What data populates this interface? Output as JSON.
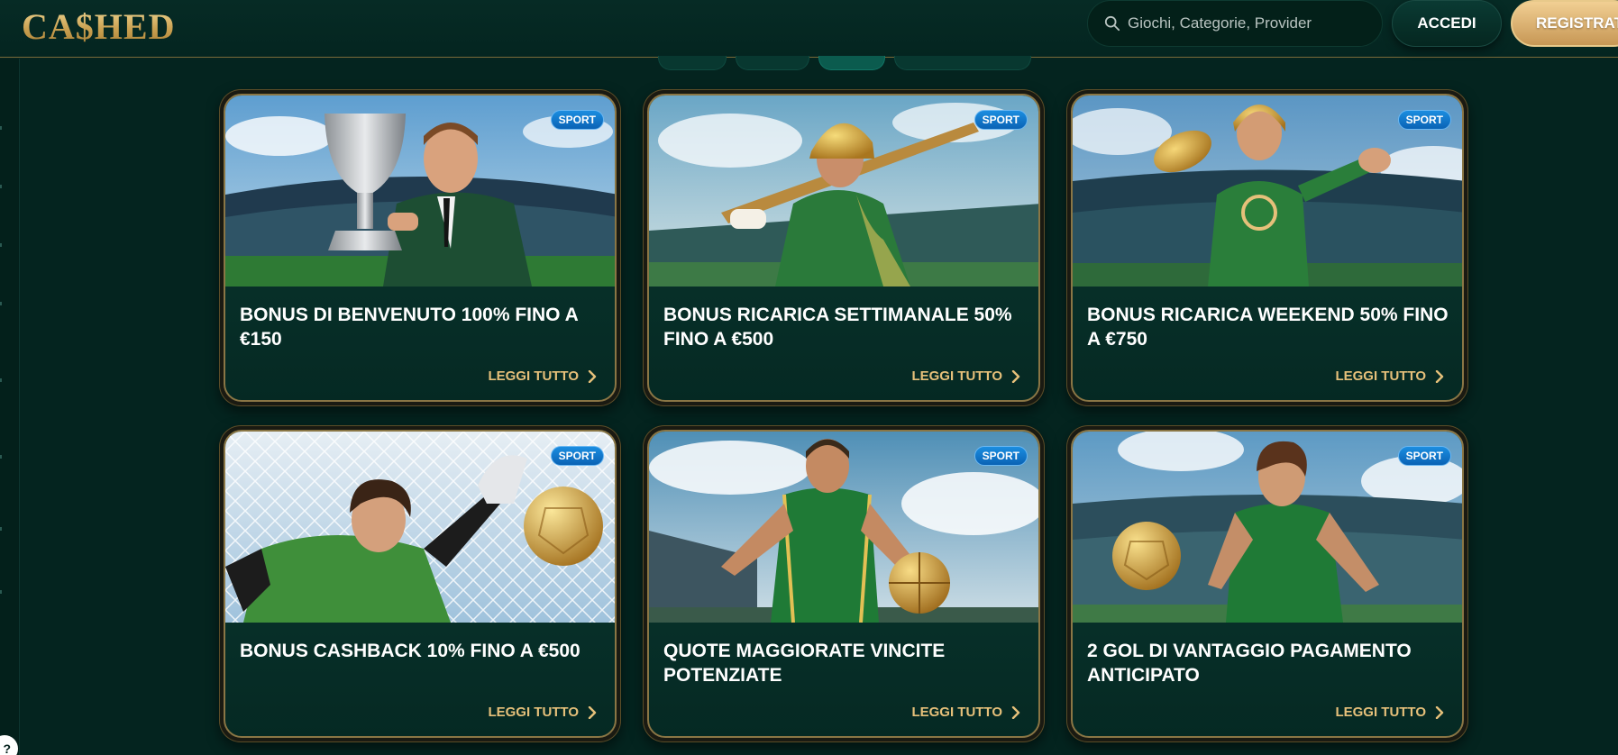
{
  "header": {
    "logo": "CA$HED",
    "search_placeholder": "Giochi, Categorie, Provider",
    "login_label": "ACCEDI",
    "register_label": "REGISTRATI"
  },
  "help": {
    "label": "?"
  },
  "cards": [
    {
      "badge": "SPORT",
      "title": "BONUS DI BENVENUTO 100% FINO A €150",
      "more": "LEGGI TUTTO"
    },
    {
      "badge": "SPORT",
      "title": "BONUS RICARICA SETTIMANALE 50% FINO A €500",
      "more": "LEGGI TUTTO"
    },
    {
      "badge": "SPORT",
      "title": "BONUS RICARICA WEEKEND 50% FINO A €750",
      "more": "LEGGI TUTTO"
    },
    {
      "badge": "SPORT",
      "title": "BONUS CASHBACK 10% FINO A €500",
      "more": "LEGGI TUTTO"
    },
    {
      "badge": "SPORT",
      "title": "QUOTE MAGGIORATE VINCITE POTENZIATE",
      "more": "LEGGI TUTTO"
    },
    {
      "badge": "SPORT",
      "title": "2 GOL DI VANTAGGIO PAGAMENTO ANTICIPATO",
      "more": "LEGGI TUTTO"
    }
  ],
  "colors": {
    "background": "#04241f",
    "gold": "#e6c07a",
    "badge_blue": "#1b8de0",
    "card_border": "#8a7645"
  }
}
